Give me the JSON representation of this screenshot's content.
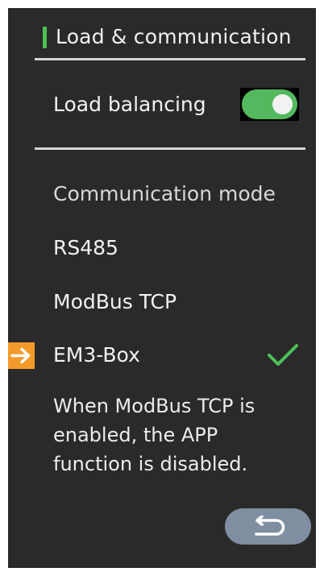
{
  "screen": {
    "title": "Load & communication",
    "load_balancing": {
      "label": "Load balancing",
      "enabled": true
    },
    "communication": {
      "heading": "Communication mode",
      "options": [
        {
          "label": "RS485",
          "selected": false
        },
        {
          "label": "ModBus TCP",
          "selected": false
        },
        {
          "label": "EM3-Box",
          "selected": true
        }
      ]
    },
    "note_lines": [
      "When ModBus TCP is",
      "enabled, the APP",
      "function is disabled."
    ],
    "icons": {
      "selection": "arrow-right-icon",
      "checkmark": "check-icon",
      "back": "return-arrow-icon"
    },
    "colors": {
      "background": "#2a2a2a",
      "accent_green": "#4cc155",
      "selection_orange": "#f39a2a",
      "back_button": "#7f8ea1"
    }
  }
}
